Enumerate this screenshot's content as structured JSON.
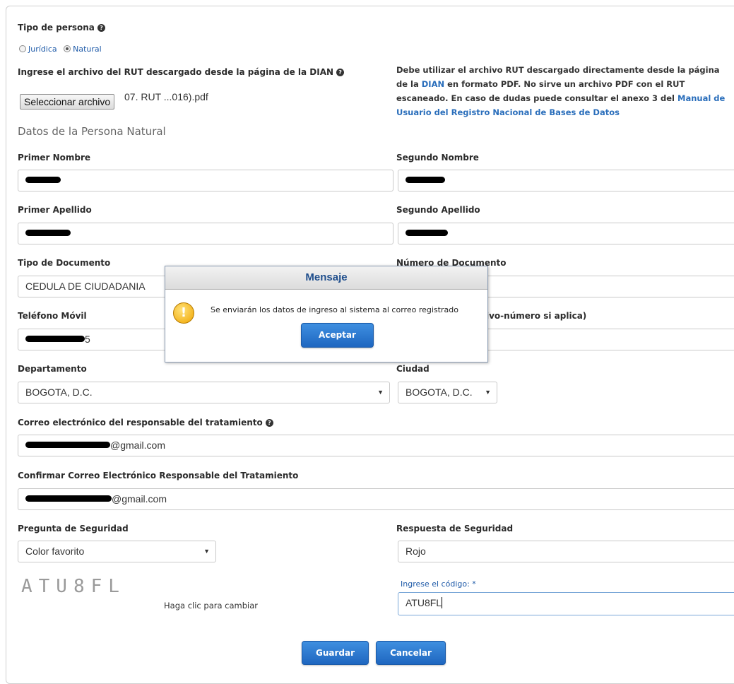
{
  "tipo_persona": {
    "label": "Tipo de persona",
    "options": [
      "Jurídica",
      "Natural"
    ],
    "selected": "Natural"
  },
  "rut": {
    "label": "Ingrese el archivo del RUT descargado desde la página de la DIAN",
    "button": "Seleccionar archivo",
    "file_name": "07. RUT ...016).pdf",
    "note_1": "Debe utilizar el archivo RUT descargado directamente desde la página de la ",
    "note_link_dian": "DIAN",
    "note_2": " en formato PDF. No sirve un archivo PDF con el RUT escaneado. En caso de dudas puede consultar el anexo 3 del ",
    "note_link_manual": "Manual de Usuario del Registro Nacional de Bases de Datos"
  },
  "section_title": "Datos de la Persona Natural",
  "fields": {
    "primer_nombre": {
      "label": "Primer Nombre"
    },
    "segundo_nombre": {
      "label": "Segundo Nombre"
    },
    "primer_apellido": {
      "label": "Primer Apellido"
    },
    "segundo_apellido": {
      "label": "Segundo Apellido"
    },
    "tipo_documento": {
      "label": "Tipo de Documento",
      "value": "CEDULA DE CIUDADANIA"
    },
    "numero_documento": {
      "label": "Número de Documento"
    },
    "telefono_movil": {
      "label": "Teléfono Móvil",
      "value_suffix": "5"
    },
    "telefono_fijo": {
      "label_visible": "ivo-número si aplica)"
    },
    "departamento": {
      "label": "Departamento",
      "value": "BOGOTA, D.C."
    },
    "ciudad": {
      "label": "Ciudad",
      "value": "BOGOTA, D.C."
    },
    "correo": {
      "label": "Correo electrónico del responsable del tratamiento",
      "value_suffix": "@gmail.com"
    },
    "confirmar_correo": {
      "label": "Confirmar Correo Electrónico Responsable del Tratamiento",
      "value_suffix": "@gmail.com"
    },
    "pregunta": {
      "label": "Pregunta de Seguridad",
      "value": "Color favorito"
    },
    "respuesta": {
      "label": "Respuesta de Seguridad",
      "value": "Rojo"
    }
  },
  "captcha": {
    "image_text": "ATU8FL",
    "change_hint": "Haga clic para cambiar",
    "code_label": "Ingrese el código: *",
    "code_value": "ATU8FL"
  },
  "actions": {
    "save": "Guardar",
    "cancel": "Cancelar"
  },
  "dialog": {
    "title": "Mensaje",
    "message": "Se enviarán los datos de ingreso al sistema al correo registrado",
    "accept": "Aceptar",
    "icon": "warning-icon"
  }
}
